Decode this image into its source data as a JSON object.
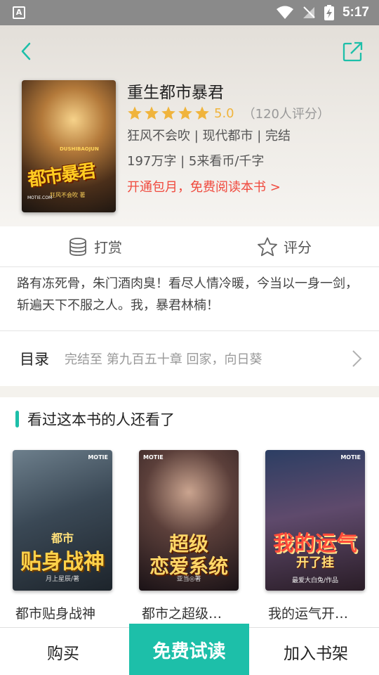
{
  "status_bar": {
    "badge": "A",
    "time": "5:17"
  },
  "book": {
    "title": "重生都市暴君",
    "rating_score": "5.0",
    "rating_count": "（120人评分）",
    "meta_line1": "狂风不会吹 | 现代都市 | 完结",
    "meta_line2": "197万字 | 5来看币/千字",
    "promo": "开通包月，免费阅读本书 >",
    "cover": {
      "title": "都市暴君",
      "subtitle": "DUSHIBAOJUN",
      "author": "狂风不会吹 著",
      "publisher": "MOTIE.COM"
    }
  },
  "actions": [
    {
      "label": "打赏",
      "icon": "coins-icon"
    },
    {
      "label": "评分",
      "icon": "star-outline-icon"
    }
  ],
  "intro": "路有冻死骨，朱门酒肉臭！看尽人情冷暖，今当以一身一剑，斩遍天下不服之人。我，暴君林楠！",
  "toc": {
    "label": "目录",
    "latest": "完结至 第九百五十章 回家，向日葵"
  },
  "recommend": {
    "title": "看过这本书的人还看了",
    "items": [
      {
        "title": "都市贴身战神",
        "cover_text": "贴身战神",
        "cover_top": "都市",
        "author": "月上星辰/著"
      },
      {
        "title": "都市之超级…",
        "cover_text": "恋爱系统",
        "cover_top": "超级",
        "author": "亚当◎著"
      },
      {
        "title": "我的运气开…",
        "cover_text": "我的运气",
        "cover_top": "开了挂",
        "author": "最爱大白兔/作品"
      }
    ],
    "logo": "MOTIE"
  },
  "bottom_bar": {
    "buy": "购买",
    "free_read": "免费试读",
    "add_shelf": "加入书架"
  },
  "colors": {
    "accent": "#1dbfa9",
    "promo": "#f04a3e",
    "star": "#f0b43c"
  }
}
